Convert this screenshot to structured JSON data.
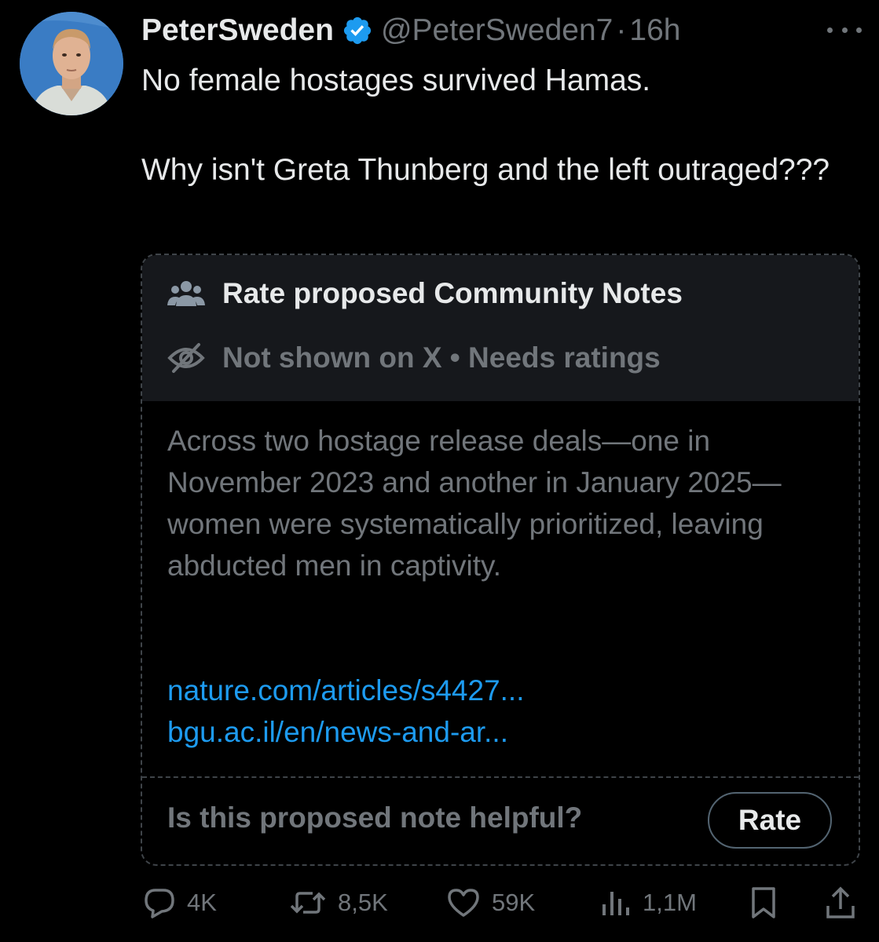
{
  "tweet": {
    "display_name": "PeterSweden",
    "handle": "@PeterSweden7",
    "separator": "·",
    "time": "16h",
    "verified_icon": "verified-badge-icon",
    "text_lines": [
      "No female hostages survived Hamas.",
      "Why isn't Greta Thunberg and the left outraged???"
    ]
  },
  "note": {
    "title": "Rate proposed Community Notes",
    "status": "Not shown on X • Needs ratings",
    "body": "Across two hostage release deals—one in November 2023 and another in January 2025—women were systematically prioritized, leaving abducted men in captivity.",
    "links": [
      "nature.com/articles/s4427...",
      "bgu.ac.il/en/news-and-ar..."
    ],
    "question": "Is this proposed note helpful?",
    "rate_label": "Rate"
  },
  "actions": {
    "replies": "4K",
    "reposts": "8,5K",
    "likes": "59K",
    "views": "1,1M"
  },
  "colors": {
    "background": "#000000",
    "text": "#e7e9ea",
    "muted": "#71767b",
    "link": "#1d9bf0",
    "verified": "#1d9bf0",
    "note_header": "#16181c"
  }
}
